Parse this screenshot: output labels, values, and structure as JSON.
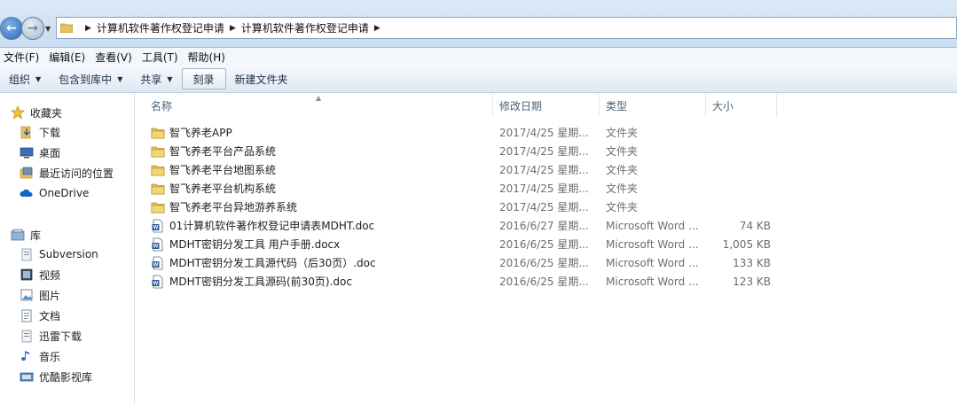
{
  "address": {
    "crumbs": [
      "计算机软件著作权登记申请",
      "计算机软件著作权登记申请"
    ]
  },
  "menu": [
    "文件(F)",
    "编辑(E)",
    "查看(V)",
    "工具(T)",
    "帮助(H)"
  ],
  "toolbar": {
    "organize": "组织",
    "include_library": "包含到库中",
    "share": "共享",
    "burn": "刻录",
    "new_folder": "新建文件夹"
  },
  "sidebar": {
    "favorites": "收藏夹",
    "favorites_items": [
      "下载",
      "桌面",
      "最近访问的位置",
      "OneDrive"
    ],
    "libraries": "库",
    "library_items": [
      "Subversion",
      "视频",
      "图片",
      "文档",
      "迅雷下载",
      "音乐",
      "优酷影视库"
    ]
  },
  "columns": {
    "name": "名称",
    "date": "修改日期",
    "type": "类型",
    "size": "大小"
  },
  "files": [
    {
      "name": "智飞养老APP",
      "date": "2017/4/25 星期...",
      "type": "文件夹",
      "size": "",
      "kind": "folder"
    },
    {
      "name": "智飞养老平台产品系统",
      "date": "2017/4/25 星期...",
      "type": "文件夹",
      "size": "",
      "kind": "folder"
    },
    {
      "name": "智飞养老平台地图系统",
      "date": "2017/4/25 星期...",
      "type": "文件夹",
      "size": "",
      "kind": "folder"
    },
    {
      "name": "智飞养老平台机构系统",
      "date": "2017/4/25 星期...",
      "type": "文件夹",
      "size": "",
      "kind": "folder"
    },
    {
      "name": "智飞养老平台异地游养系统",
      "date": "2017/4/25 星期...",
      "type": "文件夹",
      "size": "",
      "kind": "folder"
    },
    {
      "name": "01计算机软件著作权登记申请表MDHT.doc",
      "date": "2016/6/27 星期...",
      "type": "Microsoft Word ...",
      "size": "74 KB",
      "kind": "doc"
    },
    {
      "name": "MDHT密钥分发工具 用户手册.docx",
      "date": "2016/6/25 星期...",
      "type": "Microsoft Word ...",
      "size": "1,005 KB",
      "kind": "docx"
    },
    {
      "name": "MDHT密钥分发工具源代码（后30页）.doc",
      "date": "2016/6/25 星期...",
      "type": "Microsoft Word ...",
      "size": "133 KB",
      "kind": "doc"
    },
    {
      "name": "MDHT密钥分发工具源码(前30页).doc",
      "date": "2016/6/25 星期...",
      "type": "Microsoft Word ...",
      "size": "123 KB",
      "kind": "doc"
    }
  ]
}
